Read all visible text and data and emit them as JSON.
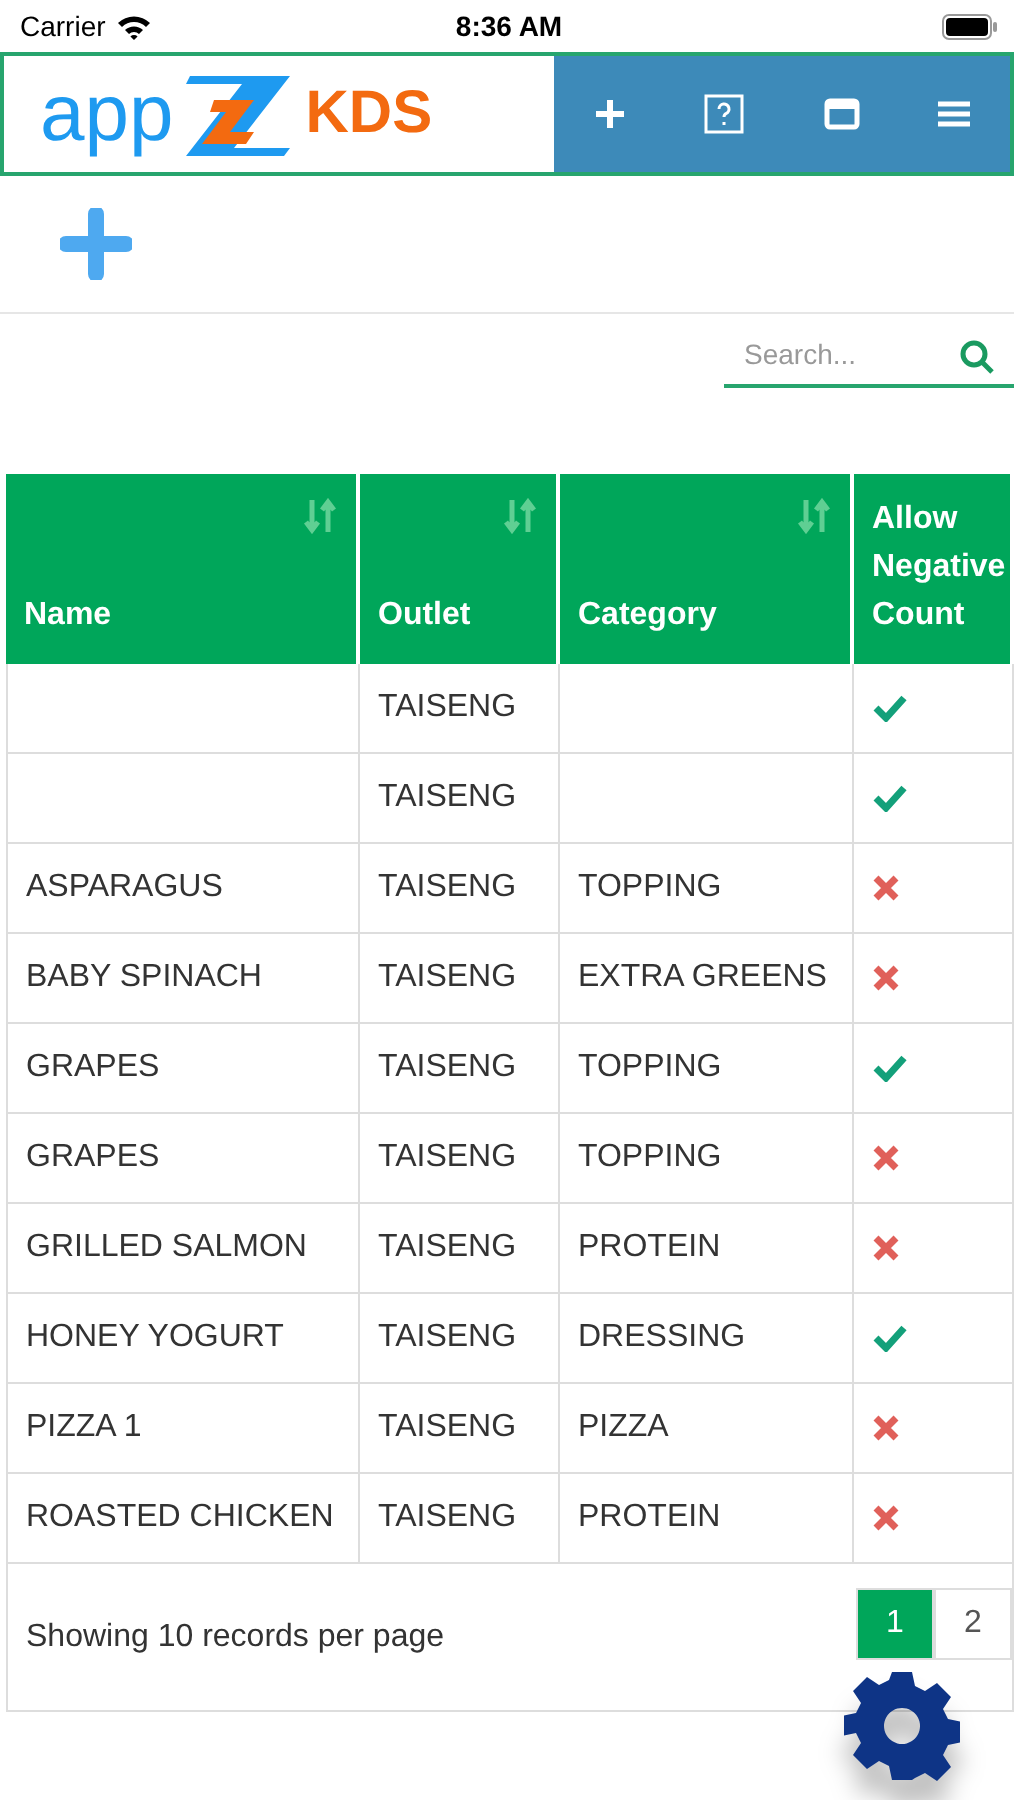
{
  "status_bar": {
    "carrier": "Carrier",
    "time": "8:36 AM"
  },
  "header": {
    "logo_left": "app",
    "logo_right": "KDS"
  },
  "search": {
    "placeholder": "Search..."
  },
  "table": {
    "columns": [
      {
        "label": "Name",
        "sortable": true
      },
      {
        "label": "Outlet",
        "sortable": true
      },
      {
        "label": "Category",
        "sortable": true
      },
      {
        "label": "Allow Negative Count",
        "sortable": false
      }
    ],
    "rows": [
      {
        "name": "",
        "outlet": "TAISENG",
        "category": "",
        "allowed": true
      },
      {
        "name": "",
        "outlet": "TAISENG",
        "category": "",
        "allowed": true
      },
      {
        "name": "ASPARAGUS",
        "outlet": "TAISENG",
        "category": "TOPPING",
        "allowed": false
      },
      {
        "name": "BABY SPINACH",
        "outlet": "TAISENG",
        "category": "EXTRA GREENS",
        "allowed": false
      },
      {
        "name": "GRAPES",
        "outlet": "TAISENG",
        "category": "TOPPING",
        "allowed": true
      },
      {
        "name": "GRAPES",
        "outlet": "TAISENG",
        "category": "TOPPING",
        "allowed": false
      },
      {
        "name": "GRILLED SALMON",
        "outlet": "TAISENG",
        "category": "PROTEIN",
        "allowed": false
      },
      {
        "name": "HONEY YOGURT",
        "outlet": "TAISENG",
        "category": "DRESSING",
        "allowed": true
      },
      {
        "name": "PIZZA 1",
        "outlet": "TAISENG",
        "category": "PIZZA",
        "allowed": false
      },
      {
        "name": "ROASTED CHICKEN",
        "outlet": "TAISENG",
        "category": "PROTEIN",
        "allowed": false
      }
    ]
  },
  "footer": {
    "summary": "Showing 10 records per page",
    "pages": [
      {
        "label": "1",
        "selected": true
      },
      {
        "label": "2",
        "selected": false
      }
    ]
  }
}
